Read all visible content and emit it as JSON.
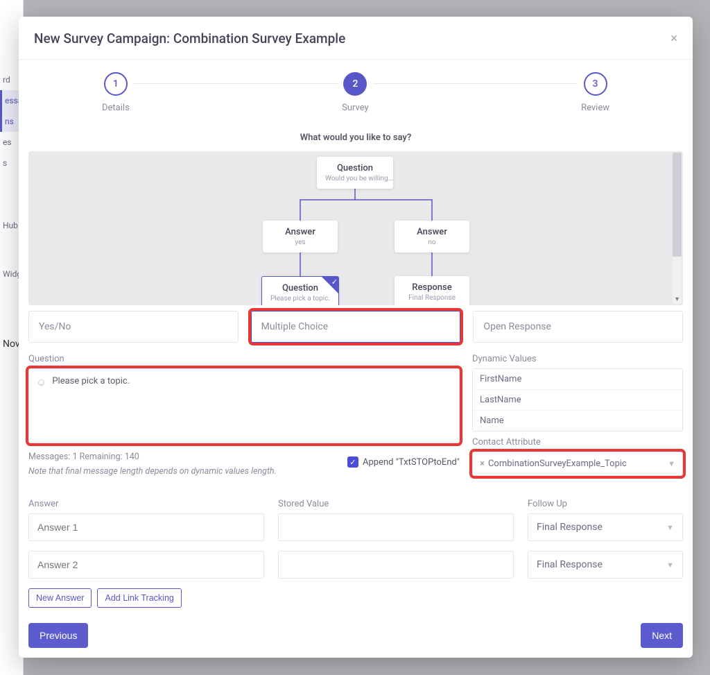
{
  "bg_sidebar": [
    "rd",
    "essag",
    "ns",
    "es",
    "s",
    "Hub",
    "Widg",
    "Nov"
  ],
  "modal": {
    "title": "New Survey Campaign: Combination Survey Example"
  },
  "steps": [
    {
      "num": "1",
      "label": "Details",
      "active": false
    },
    {
      "num": "2",
      "label": "Survey",
      "active": true
    },
    {
      "num": "3",
      "label": "Review",
      "active": false
    }
  ],
  "prompt": "What would you like to say?",
  "tree": {
    "root": {
      "title": "Question",
      "sub": "Would you be willing..."
    },
    "ans_yes": {
      "title": "Answer",
      "sub": "yes"
    },
    "ans_no": {
      "title": "Answer",
      "sub": "no"
    },
    "q2": {
      "title": "Question",
      "sub": "Please pick a topic."
    },
    "resp": {
      "title": "Response",
      "sub": "Final Response"
    }
  },
  "tabs": {
    "yesno": "Yes/No",
    "multiple": "Multiple Choice",
    "open": "Open Response"
  },
  "question": {
    "label": "Question",
    "text": "Please pick a topic."
  },
  "messages_meta": "Messages: 1 Remaining: 140",
  "messages_note": "Note that final message length depends on dynamic values length.",
  "append_label": "Append \"TxtSTOPtoEnd\"",
  "dynamic": {
    "label": "Dynamic Values",
    "items": [
      "FirstName",
      "LastName",
      "Name"
    ]
  },
  "contact_attr": {
    "label": "Contact Attribute",
    "value": "CombinationSurveyExample_Topic"
  },
  "answers": {
    "answer_label": "Answer",
    "stored_label": "Stored Value",
    "followup_label": "Follow Up",
    "rows": [
      {
        "answer": "Answer 1",
        "stored": "",
        "followup": "Final Response"
      },
      {
        "answer": "Answer 2",
        "stored": "",
        "followup": "Final Response"
      }
    ]
  },
  "buttons": {
    "new_answer": "New Answer",
    "add_link": "Add Link Tracking",
    "previous": "Previous",
    "next": "Next"
  }
}
